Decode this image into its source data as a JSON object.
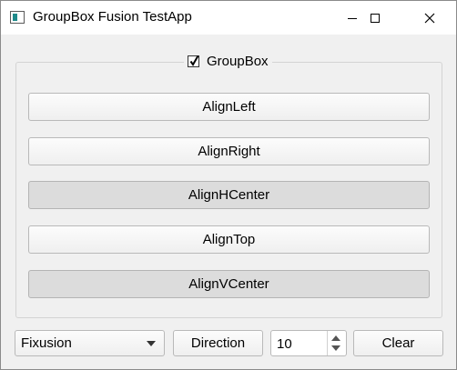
{
  "window": {
    "title": "GroupBox Fusion TestApp",
    "controls": [
      "minimize-icon",
      "maximize-icon",
      "close-icon"
    ]
  },
  "groupbox": {
    "label": "GroupBox",
    "checked": true,
    "buttons": [
      {
        "label": "AlignLeft",
        "pressed": false
      },
      {
        "label": "AlignRight",
        "pressed": false
      },
      {
        "label": "AlignHCenter",
        "pressed": true
      },
      {
        "label": "AlignTop",
        "pressed": false
      },
      {
        "label": "AlignVCenter",
        "pressed": true
      }
    ]
  },
  "bottom": {
    "style_combo": {
      "value": "Fixusion"
    },
    "direction_label": "Direction",
    "spin_value": "10",
    "clear_label": "Clear"
  }
}
